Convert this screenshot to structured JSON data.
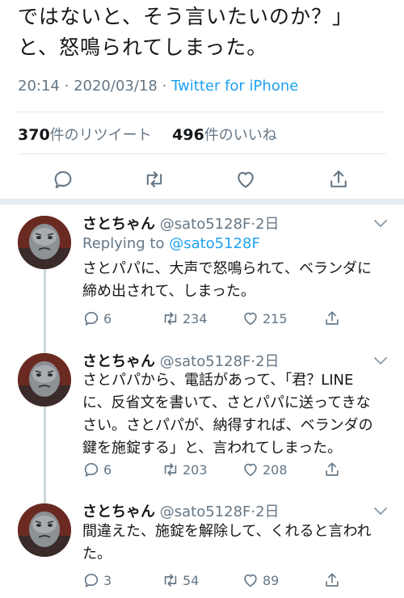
{
  "tweet": {
    "text_lines": [
      "ではないと、そう言いたいのか？」",
      "と、怒鳴られてしまった。"
    ],
    "time": "20:14",
    "date": "2020/03/18",
    "dot": "·",
    "source": "Twitter for iPhone",
    "retweets_count": "370",
    "retweets_label": "件のリツイート",
    "likes_count": "496",
    "likes_label": "件のいいね"
  },
  "replies": [
    {
      "name": "さとちゃん",
      "handle": "@sato5128F",
      "dot": "·",
      "age": "2日",
      "replying_prefix": "Replying to ",
      "replying_to": "@sato5128F",
      "text_lines": [
        "さとパパに、大声で怒鳴られて、ベランダに",
        "締め出されて、しまった。"
      ],
      "replies": "6",
      "retweets": "234",
      "likes": "215"
    },
    {
      "name": "さとちゃん",
      "handle": "@sato5128F",
      "dot": "·",
      "age": "2日",
      "text_lines": [
        "さとパパから、電話があって、「君？LINE",
        "に、反省文を書いて、さとパパに送ってきな",
        "さい。さとパパが、納得すれば、ベランダの",
        "鍵を施錠する」と、言われてしまった。"
      ],
      "replies": "6",
      "retweets": "203",
      "likes": "208"
    },
    {
      "name": "さとちゃん",
      "handle": "@sato5128F",
      "dot": "·",
      "age": "2日",
      "text_lines": [
        "間違えた、施錠を解除して、くれると言われ",
        "た。"
      ],
      "replies": "3",
      "retweets": "54",
      "likes": "89"
    }
  ],
  "icons": [
    "reply-icon",
    "retweet-icon",
    "like-icon",
    "share-icon",
    "chevron-down-icon",
    "avatar"
  ],
  "colors": {
    "link": "#1da1f2",
    "muted": "#657786",
    "text": "#14171a",
    "divider": "#e6ecf0"
  }
}
